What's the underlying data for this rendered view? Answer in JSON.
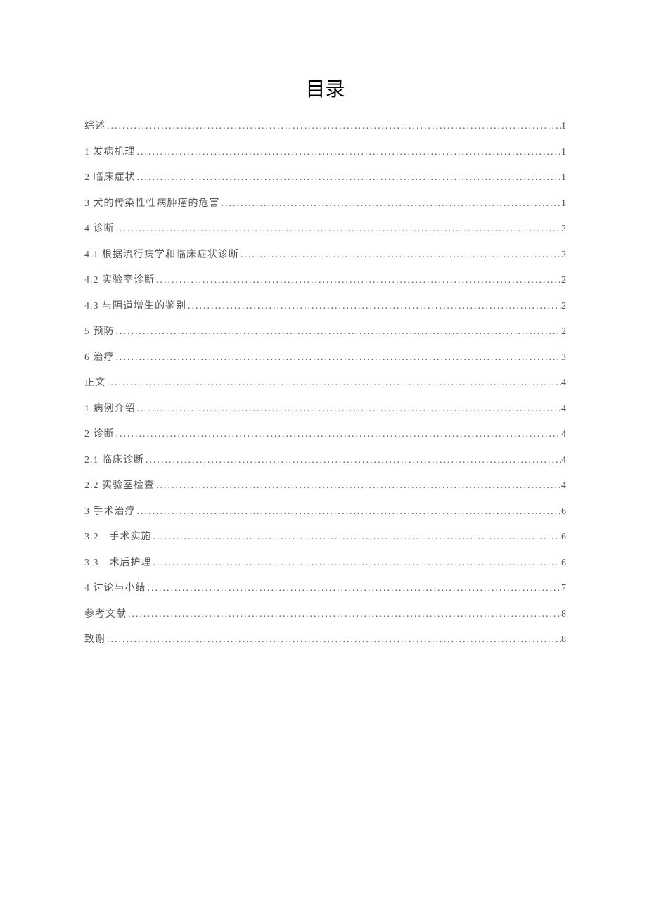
{
  "title": "目录",
  "entries": [
    {
      "label": "综述",
      "page": "1"
    },
    {
      "label": "1 发病机理",
      "page": "1"
    },
    {
      "label": "2 临床症状",
      "page": "1"
    },
    {
      "label": "3 犬的传染性性病肿瘤的危害",
      "page": "1"
    },
    {
      "label": "4 诊断",
      "page": "2"
    },
    {
      "label": "4.1 根据流行病学和临床症状诊断",
      "page": "2"
    },
    {
      "label": "4.2 实验室诊断",
      "page": "2"
    },
    {
      "label": "4.3 与阴道增生的鉴别",
      "page": "2"
    },
    {
      "label": "5 预防",
      "page": "2"
    },
    {
      "label": "6 治疗",
      "page": "3"
    },
    {
      "label": "正文",
      "page": "4"
    },
    {
      "label": "1 病例介绍",
      "page": "4"
    },
    {
      "label": "2 诊断",
      "page": "4"
    },
    {
      "label": "2.1 临床诊断",
      "page": "4"
    },
    {
      "label": "2.2 实验室检查",
      "page": "4"
    },
    {
      "label": "3 手术治疗",
      "page": "6"
    },
    {
      "label": "3.2　手术实施",
      "page": "6"
    },
    {
      "label": "3.3　术后护理",
      "page": "6"
    },
    {
      "label": "4 讨论与小结",
      "page": "7"
    },
    {
      "label": "参考文献",
      "page": "8"
    },
    {
      "label": "致谢",
      "page": "8"
    }
  ]
}
